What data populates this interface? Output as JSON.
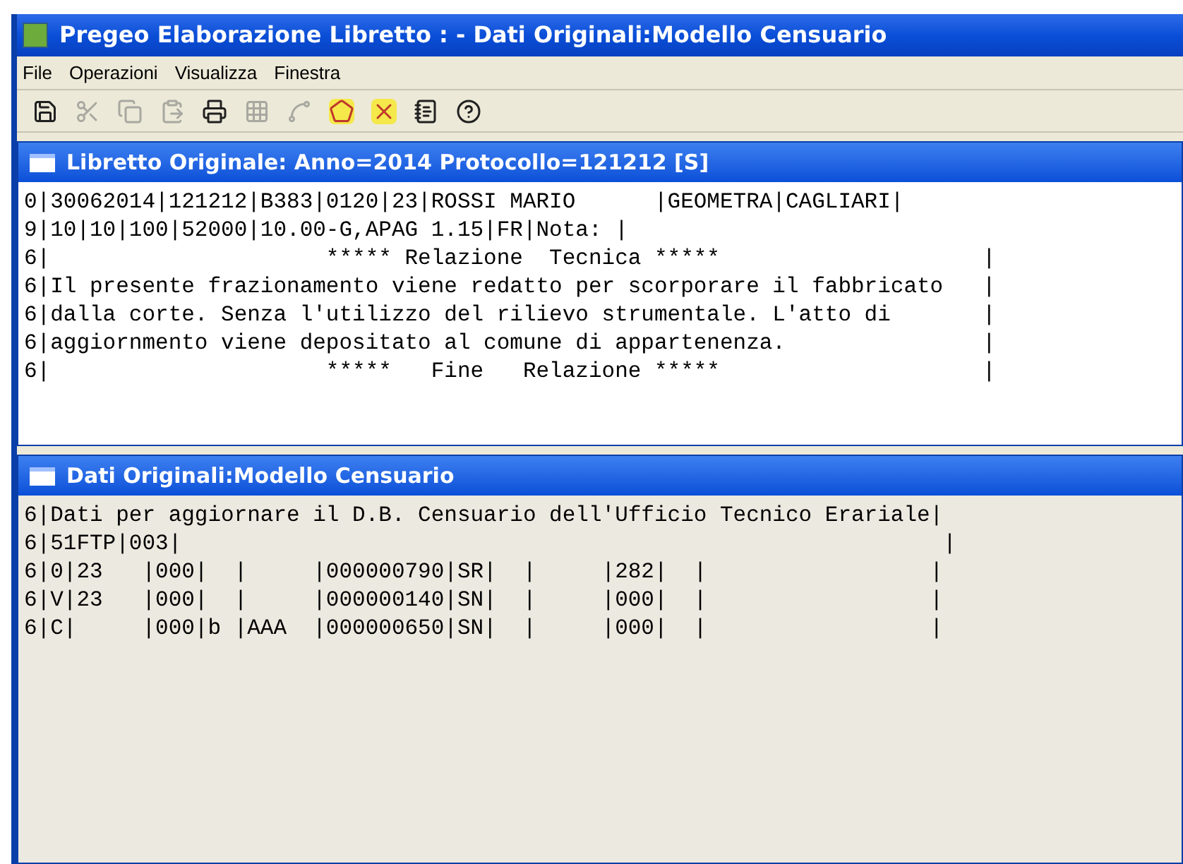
{
  "window": {
    "title": "Pregeo Elaborazione Libretto : - Dati Originali:Modello Censuario"
  },
  "menu": [
    "File",
    "Operazioni",
    "Visualizza",
    "Finestra"
  ],
  "toolbar": [
    {
      "kind": "save",
      "disabled": false
    },
    {
      "kind": "cut",
      "disabled": true
    },
    {
      "kind": "copy",
      "disabled": true
    },
    {
      "kind": "paste",
      "disabled": true
    },
    {
      "kind": "print",
      "disabled": false
    },
    {
      "kind": "grid",
      "disabled": true
    },
    {
      "kind": "shape",
      "disabled": true
    },
    {
      "kind": "polygon",
      "disabled": false
    },
    {
      "kind": "cross",
      "disabled": false
    },
    {
      "kind": "notes",
      "disabled": false
    },
    {
      "kind": "help",
      "disabled": false
    }
  ],
  "panels": [
    {
      "title": "Libretto Originale: Anno=2014 Protocollo=121212 [S]",
      "lines": [
        "0|30062014|121212|B383|0120|23|ROSSI MARIO      |GEOMETRA|CAGLIARI|",
        "9|10|10|100|52000|10.00-G,APAG 1.15|FR|Nota: |",
        "6|                     ***** Relazione  Tecnica *****                    |",
        "6|Il presente frazionamento viene redatto per scorporare il fabbricato   |",
        "6|dalla corte. Senza l'utilizzo del rilievo strumentale. L'atto di       |",
        "6|aggiornmento viene depositato al comune di appartenenza.               |",
        "6|                     *****   Fine   Relazione *****                    |"
      ]
    },
    {
      "title": "Dati Originali:Modello Censuario",
      "lines": [
        "6|Dati per aggiornare il D.B. Censuario dell'Ufficio Tecnico Erariale|",
        "6|51FTP|003|                                                          |",
        "6|0|23   |000|  |     |000000790|SR|  |     |282|  |                 |",
        "6|V|23   |000|  |     |000000140|SN|  |     |000|  |                 |",
        "6|C|     |000|b |AAA  |000000650|SN|  |     |000|  |                 |"
      ]
    }
  ]
}
